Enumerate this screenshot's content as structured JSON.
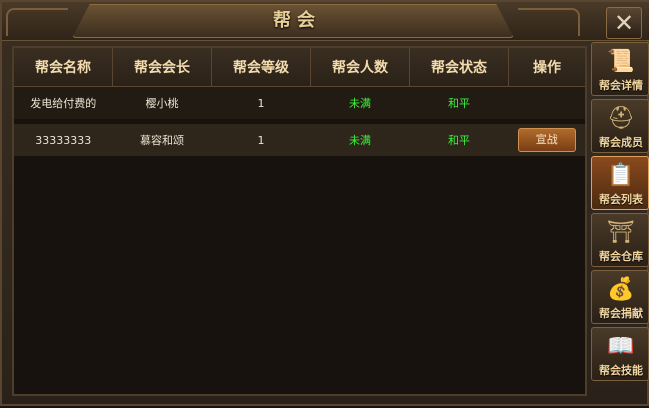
{
  "window": {
    "title": "帮会",
    "close_icon": "✕"
  },
  "table": {
    "headers": [
      "帮会名称",
      "帮会会长",
      "帮会等级",
      "帮会人数",
      "帮会状态",
      "操作"
    ],
    "rows": [
      {
        "name": "发电给付费的",
        "leader": "樱小桃",
        "level": "1",
        "members": "未满",
        "status": "和平",
        "action": ""
      },
      {
        "name": "33333333",
        "leader": "慕容和颂",
        "level": "1",
        "members": "未满",
        "status": "和平",
        "action": "宣战"
      }
    ]
  },
  "sidebar": {
    "items": [
      {
        "label": "帮会详情",
        "icon": "scroll-icon",
        "active": false
      },
      {
        "label": "帮会成员",
        "icon": "helmet-icon",
        "active": false
      },
      {
        "label": "帮会列表",
        "icon": "list-scroll-icon",
        "active": true
      },
      {
        "label": "帮会仓库",
        "icon": "warehouse-icon",
        "active": false
      },
      {
        "label": "帮会捐献",
        "icon": "donate-icon",
        "active": false
      },
      {
        "label": "帮会技能",
        "icon": "skill-book-icon",
        "active": false
      }
    ]
  },
  "colors": {
    "status_green": "#3cf23c",
    "header_text": "#f2dcae",
    "accent": "#b06a2c"
  }
}
